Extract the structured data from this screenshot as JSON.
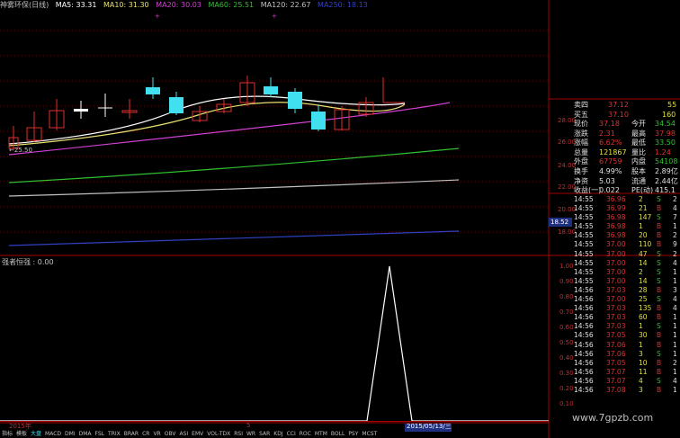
{
  "header": {
    "stock": "神雾环保(日线)",
    "ma5": "MA5: 33.31",
    "ma10": "MA10: 31.30",
    "ma20": "MA20: 30.03",
    "ma60": "MA60: 25.51",
    "ma120": "MA120: 22.67",
    "ma250": "MA250: 18.13"
  },
  "colors": {
    "ma5": "#ffffff",
    "ma10": "#e8e070",
    "ma20": "#d040d0",
    "ma60": "#30c030",
    "ma120": "#c0c0c0",
    "ma250": "#3040c0",
    "up": "#e03030",
    "down": "#40e0f0"
  },
  "price_axis": [
    "28.00",
    "26.00",
    "24.00",
    "22.00",
    "20.00",
    "18.00"
  ],
  "low_label": "←25.50",
  "current_price_tag": "18.52",
  "indicator": {
    "title": "强者恒强 : 0.00",
    "axis": [
      "1.00",
      "0.90",
      "0.80",
      "0.70",
      "0.60",
      "0.50",
      "0.40",
      "0.30",
      "0.20",
      "0.10"
    ]
  },
  "date_bar": {
    "year": "2015年",
    "month": "5",
    "cursor_date": "2015/05/13/三"
  },
  "tabs": [
    "指标",
    "模板",
    "大盘",
    "MACD",
    "DMI",
    "DMA",
    "FSL",
    "TRIX",
    "BRAR",
    "CR",
    "VR",
    "OBV",
    "ASI",
    "EMV",
    "VOL-TDX",
    "RSI",
    "WR",
    "SAR",
    "KDJ",
    "CCI",
    "ROC",
    "MTM",
    "BOLL",
    "PSY",
    "MCST"
  ],
  "orderbook": [
    {
      "label": "卖四",
      "price": "37.12",
      "vol": "55"
    },
    {
      "label": "买五",
      "price": "37.10",
      "vol": "160"
    }
  ],
  "quote": [
    {
      "l1": "现价",
      "v1": "37.18",
      "l2": "今开",
      "v2": "34.54",
      "c1": "#e03030",
      "c2": "#30c030"
    },
    {
      "l1": "涨跌",
      "v1": "2.31",
      "l2": "最高",
      "v2": "37.98",
      "c1": "#e03030",
      "c2": "#e03030"
    },
    {
      "l1": "涨幅",
      "v1": "6.62%",
      "l2": "最低",
      "v2": "33.50",
      "c1": "#e03030",
      "c2": "#30c030"
    },
    {
      "l1": "总量",
      "v1": "121867",
      "l2": "量比",
      "v2": "1.24",
      "c1": "#e0e040",
      "c2": "#e03030"
    },
    {
      "l1": "外盘",
      "v1": "67759",
      "l2": "内盘",
      "v2": "54108",
      "c1": "#e03030",
      "c2": "#30c030"
    },
    {
      "l1": "换手",
      "v1": "4.99%",
      "l2": "股本",
      "v2": "2.89亿",
      "c1": "#e0e0e0",
      "c2": "#e0e0e0"
    },
    {
      "l1": "净资",
      "v1": "5.03",
      "l2": "流通",
      "v2": "2.44亿",
      "c1": "#e0e0e0",
      "c2": "#e0e0e0"
    },
    {
      "l1": "收益(一)",
      "v1": "0.022",
      "l2": "PE(动)",
      "v2": "415.1",
      "c1": "#e0e0e0",
      "c2": "#e0e0e0"
    }
  ],
  "ticks": [
    {
      "t": "14:55",
      "p": "36.96",
      "v": "2",
      "d": "S",
      "n": "2"
    },
    {
      "t": "14:55",
      "p": "36.99",
      "v": "21",
      "d": "B",
      "n": "4"
    },
    {
      "t": "14:55",
      "p": "36.98",
      "v": "147",
      "d": "S",
      "n": "7"
    },
    {
      "t": "14:55",
      "p": "36.98",
      "v": "1",
      "d": "B",
      "n": "1"
    },
    {
      "t": "14:55",
      "p": "36.98",
      "v": "20",
      "d": "B",
      "n": "2"
    },
    {
      "t": "14:55",
      "p": "37.00",
      "v": "110",
      "d": "B",
      "n": "9"
    },
    {
      "t": "14:55",
      "p": "37.00",
      "v": "47",
      "d": "S",
      "n": "2"
    },
    {
      "t": "14:55",
      "p": "37.00",
      "v": "14",
      "d": "S",
      "n": "4"
    },
    {
      "t": "14:55",
      "p": "37.00",
      "v": "2",
      "d": "S",
      "n": "1"
    },
    {
      "t": "14:55",
      "p": "37.00",
      "v": "14",
      "d": "S",
      "n": "1"
    },
    {
      "t": "14:56",
      "p": "37.03",
      "v": "28",
      "d": "B",
      "n": "3"
    },
    {
      "t": "14:56",
      "p": "37.00",
      "v": "25",
      "d": "S",
      "n": "4"
    },
    {
      "t": "14:56",
      "p": "37.03",
      "v": "135",
      "d": "B",
      "n": "4"
    },
    {
      "t": "14:56",
      "p": "37.03",
      "v": "60",
      "d": "B",
      "n": "1"
    },
    {
      "t": "14:56",
      "p": "37.03",
      "v": "1",
      "d": "S",
      "n": "1"
    },
    {
      "t": "14:56",
      "p": "37.05",
      "v": "30",
      "d": "B",
      "n": "1"
    },
    {
      "t": "14:56",
      "p": "37.06",
      "v": "1",
      "d": "B",
      "n": "1"
    },
    {
      "t": "14:56",
      "p": "37.06",
      "v": "3",
      "d": "S",
      "n": "1"
    },
    {
      "t": "14:56",
      "p": "37.05",
      "v": "10",
      "d": "B",
      "n": "2"
    },
    {
      "t": "14:56",
      "p": "37.07",
      "v": "11",
      "d": "B",
      "n": "1"
    },
    {
      "t": "14:56",
      "p": "37.07",
      "v": "4",
      "d": "S",
      "n": "4"
    },
    {
      "t": "14:56",
      "p": "37.08",
      "v": "3",
      "d": "B",
      "n": "1"
    }
  ],
  "watermark": "www.7gpzb.com"
}
